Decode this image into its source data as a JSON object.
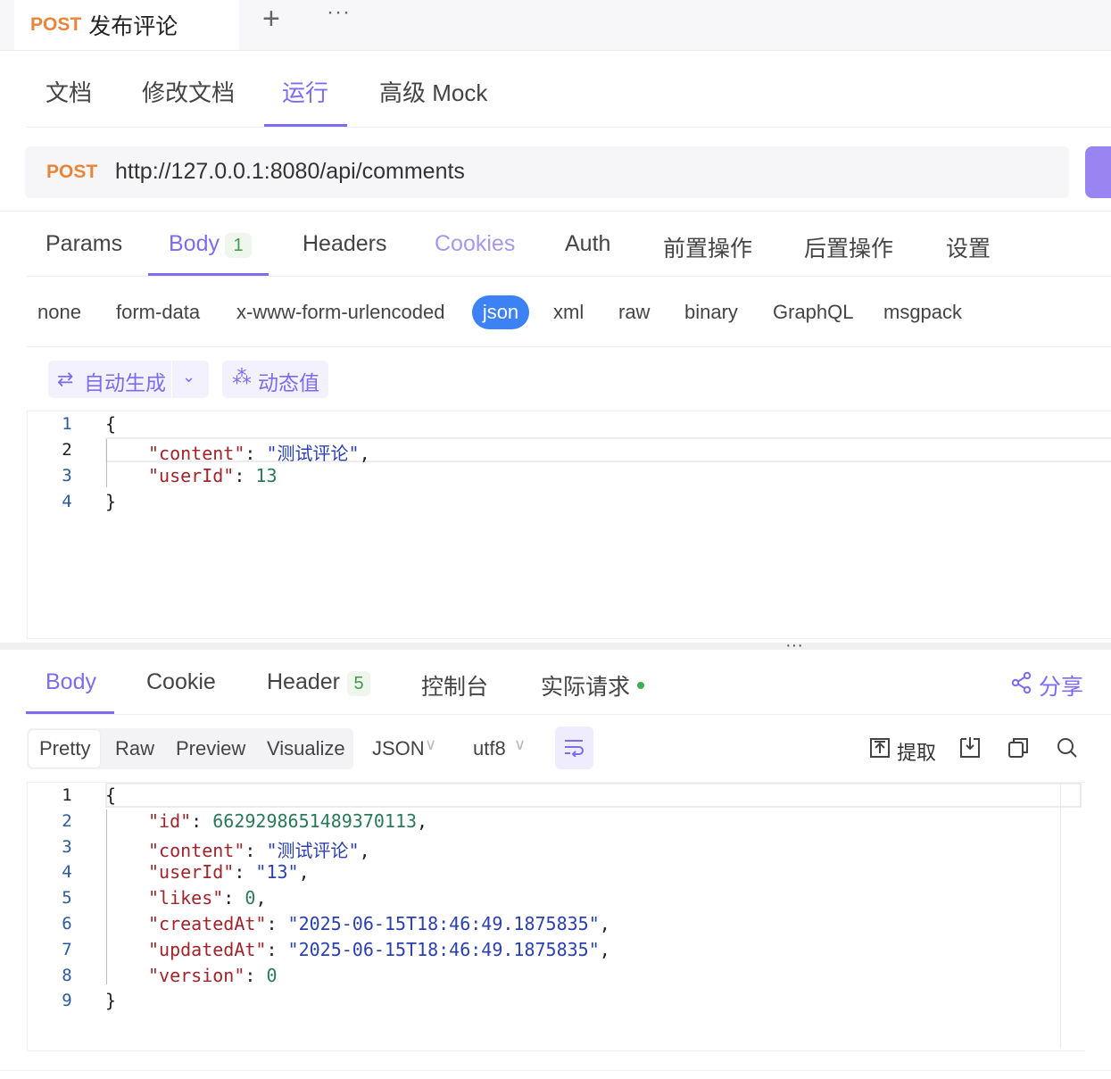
{
  "top_tab": {
    "method": "POST",
    "title": "发布评论",
    "add": "+",
    "more": "···"
  },
  "doc_tabs": [
    "文档",
    "修改文档",
    "运行",
    "高级 Mock"
  ],
  "url": {
    "method": "POST",
    "value": "http://127.0.0.1:8080/api/comments"
  },
  "req_tabs": {
    "params": "Params",
    "body": "Body",
    "body_count": "1",
    "headers": "Headers",
    "cookies": "Cookies",
    "auth": "Auth",
    "pre": "前置操作",
    "post": "后置操作",
    "settings": "设置"
  },
  "body_types": [
    "none",
    "form-data",
    "x-www-form-urlencoded",
    "json",
    "xml",
    "raw",
    "binary",
    "GraphQL",
    "msgpack"
  ],
  "body_tools": {
    "auto": "自动生成",
    "dynamic": "动态值"
  },
  "request_body": {
    "line_numbers": [
      "1",
      "2",
      "3",
      "4"
    ],
    "open": "{",
    "content_key": "\"content\"",
    "content_value": "\"测试评论\"",
    "userId_key": "\"userId\"",
    "userId_value": "13",
    "close": "}"
  },
  "resp_tabs": {
    "body": "Body",
    "cookie": "Cookie",
    "header": "Header",
    "header_count": "5",
    "console": "控制台",
    "actual": "实际请求",
    "share": "分享"
  },
  "view": {
    "pretty": "Pretty",
    "raw": "Raw",
    "preview": "Preview",
    "visualize": "Visualize",
    "format": "JSON",
    "encoding": "utf8",
    "extract": "提取"
  },
  "response_body": {
    "line_numbers": [
      "1",
      "2",
      "3",
      "4",
      "5",
      "6",
      "7",
      "8",
      "9"
    ],
    "open": "{",
    "id_key": "\"id\"",
    "id_value": "6629298651489370113",
    "content_key": "\"content\"",
    "content_value": "\"测试评论\"",
    "userId_key": "\"userId\"",
    "userId_value": "\"13\"",
    "likes_key": "\"likes\"",
    "likes_value": "0",
    "createdAt_key": "\"createdAt\"",
    "createdAt_value": "\"2025-06-15T18:46:49.1875835\"",
    "updatedAt_key": "\"updatedAt\"",
    "updatedAt_value": "\"2025-06-15T18:46:49.1875835\"",
    "version_key": "\"version\"",
    "version_value": "0",
    "close": "}"
  },
  "colors": {
    "accent": "#7b6cf0",
    "method": "#e8853a",
    "json_pill": "#3d82f5",
    "count_green": "#3f9d49"
  }
}
